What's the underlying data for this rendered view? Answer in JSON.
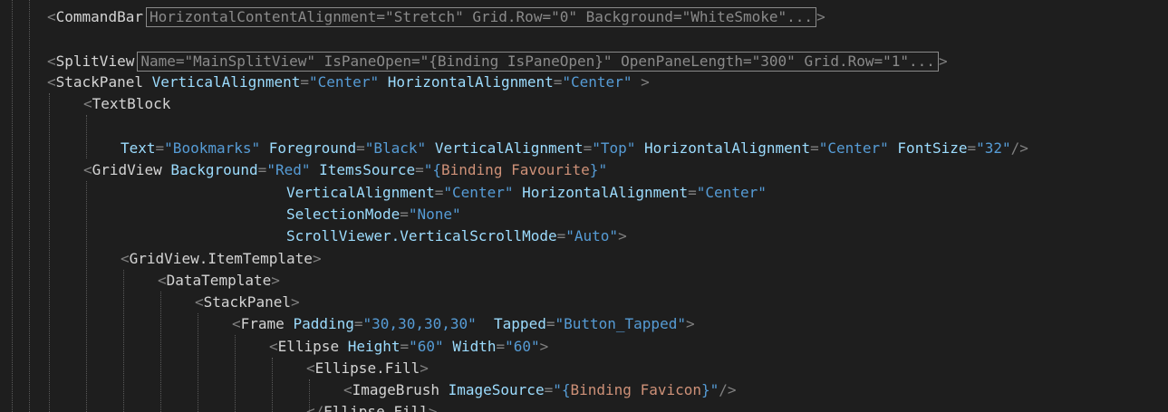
{
  "colors": {
    "background": "#1e1e1e",
    "punctuation": "#808080",
    "tag": "#d4d4d4",
    "attribute": "#9cdcfe",
    "string": "#569cd6",
    "binding": "#ce9178",
    "collapsed": "#8a8a8a",
    "indent_guide": "#5a5a5a"
  },
  "lines": [
    {
      "id": "commandbar",
      "tokens": [
        {
          "t": "punc",
          "v": "<"
        },
        {
          "t": "tag",
          "v": "CommandBar"
        }
      ],
      "collapsed": "HorizontalContentAlignment=\"Stretch\" Grid.Row=\"0\" Background=\"WhiteSmoke\"...",
      "collapsed_end": ">"
    },
    {
      "id": "splitview",
      "tokens": [
        {
          "t": "punc",
          "v": "<"
        },
        {
          "t": "tag",
          "v": "SplitView"
        }
      ],
      "collapsed": "Name=\"MainSplitView\" IsPaneOpen=\"{Binding IsPaneOpen}\" OpenPaneLength=\"300\" Grid.Row=\"1\"...",
      "collapsed_end": ">"
    },
    {
      "id": "stackpanel-outer",
      "tokens": [
        {
          "t": "punc",
          "v": "<"
        },
        {
          "t": "tag",
          "v": "StackPanel"
        },
        {
          "t": "text",
          "v": " "
        },
        {
          "t": "attr",
          "v": "VerticalAlignment"
        },
        {
          "t": "punc",
          "v": "="
        },
        {
          "t": "str",
          "v": "\"Center\""
        },
        {
          "t": "text",
          "v": " "
        },
        {
          "t": "attr",
          "v": "HorizontalAlignment"
        },
        {
          "t": "punc",
          "v": "="
        },
        {
          "t": "str",
          "v": "\"Center\""
        },
        {
          "t": "text",
          "v": " "
        },
        {
          "t": "punc",
          "v": ">"
        }
      ]
    },
    {
      "id": "textblock-open",
      "tokens": [
        {
          "t": "punc",
          "v": "<"
        },
        {
          "t": "tag",
          "v": "TextBlock"
        }
      ]
    },
    {
      "id": "textblock-attrs",
      "tokens": [
        {
          "t": "attr",
          "v": "Text"
        },
        {
          "t": "punc",
          "v": "="
        },
        {
          "t": "str",
          "v": "\"Bookmarks\""
        },
        {
          "t": "text",
          "v": " "
        },
        {
          "t": "attr",
          "v": "Foreground"
        },
        {
          "t": "punc",
          "v": "="
        },
        {
          "t": "str",
          "v": "\"Black\""
        },
        {
          "t": "text",
          "v": " "
        },
        {
          "t": "attr",
          "v": "VerticalAlignment"
        },
        {
          "t": "punc",
          "v": "="
        },
        {
          "t": "str",
          "v": "\"Top\""
        },
        {
          "t": "text",
          "v": " "
        },
        {
          "t": "attr",
          "v": "HorizontalAlignment"
        },
        {
          "t": "punc",
          "v": "="
        },
        {
          "t": "str",
          "v": "\"Center\""
        },
        {
          "t": "text",
          "v": " "
        },
        {
          "t": "attr",
          "v": "FontSize"
        },
        {
          "t": "punc",
          "v": "="
        },
        {
          "t": "str",
          "v": "\"32\""
        },
        {
          "t": "punc",
          "v": "/>"
        }
      ]
    },
    {
      "id": "gridview-open",
      "tokens": [
        {
          "t": "punc",
          "v": "<"
        },
        {
          "t": "tag",
          "v": "GridView"
        },
        {
          "t": "text",
          "v": " "
        },
        {
          "t": "attr",
          "v": "Background"
        },
        {
          "t": "punc",
          "v": "="
        },
        {
          "t": "str",
          "v": "\"Red\""
        },
        {
          "t": "text",
          "v": " "
        },
        {
          "t": "attr",
          "v": "ItemsSource"
        },
        {
          "t": "punc",
          "v": "="
        },
        {
          "t": "str",
          "v": "\""
        },
        {
          "t": "str",
          "v": "{"
        },
        {
          "t": "bind",
          "v": "Binding"
        },
        {
          "t": "text",
          "v": " "
        },
        {
          "t": "bind",
          "v": "Favourite"
        },
        {
          "t": "str",
          "v": "}"
        },
        {
          "t": "str",
          "v": "\""
        }
      ]
    },
    {
      "id": "gridview-alignment",
      "tokens": [
        {
          "t": "attr",
          "v": "VerticalAlignment"
        },
        {
          "t": "punc",
          "v": "="
        },
        {
          "t": "str",
          "v": "\"Center\""
        },
        {
          "t": "text",
          "v": " "
        },
        {
          "t": "attr",
          "v": "HorizontalAlignment"
        },
        {
          "t": "punc",
          "v": "="
        },
        {
          "t": "str",
          "v": "\"Center\""
        }
      ]
    },
    {
      "id": "gridview-selection",
      "tokens": [
        {
          "t": "attr",
          "v": "SelectionMode"
        },
        {
          "t": "punc",
          "v": "="
        },
        {
          "t": "str",
          "v": "\"None\""
        }
      ]
    },
    {
      "id": "gridview-scroll",
      "tokens": [
        {
          "t": "attr",
          "v": "ScrollViewer.VerticalScrollMode"
        },
        {
          "t": "punc",
          "v": "="
        },
        {
          "t": "str",
          "v": "\"Auto\""
        },
        {
          "t": "punc",
          "v": ">"
        }
      ]
    },
    {
      "id": "itemtemplate-open",
      "tokens": [
        {
          "t": "punc",
          "v": "<"
        },
        {
          "t": "tag",
          "v": "GridView.ItemTemplate"
        },
        {
          "t": "punc",
          "v": ">"
        }
      ]
    },
    {
      "id": "datatemplate-open",
      "tokens": [
        {
          "t": "punc",
          "v": "<"
        },
        {
          "t": "tag",
          "v": "DataTemplate"
        },
        {
          "t": "punc",
          "v": ">"
        }
      ]
    },
    {
      "id": "stackpanel-inner",
      "tokens": [
        {
          "t": "punc",
          "v": "<"
        },
        {
          "t": "tag",
          "v": "StackPanel"
        },
        {
          "t": "punc",
          "v": ">"
        }
      ]
    },
    {
      "id": "frame-open",
      "tokens": [
        {
          "t": "punc",
          "v": "<"
        },
        {
          "t": "tag",
          "v": "Frame"
        },
        {
          "t": "text",
          "v": " "
        },
        {
          "t": "attr",
          "v": "Padding"
        },
        {
          "t": "punc",
          "v": "="
        },
        {
          "t": "str",
          "v": "\"30,30,30,30\""
        },
        {
          "t": "text",
          "v": "  "
        },
        {
          "t": "attr",
          "v": "Tapped"
        },
        {
          "t": "punc",
          "v": "="
        },
        {
          "t": "str",
          "v": "\"Button_Tapped\""
        },
        {
          "t": "punc",
          "v": ">"
        }
      ]
    },
    {
      "id": "ellipse-open",
      "tokens": [
        {
          "t": "punc",
          "v": "<"
        },
        {
          "t": "tag",
          "v": "Ellipse"
        },
        {
          "t": "text",
          "v": " "
        },
        {
          "t": "attr",
          "v": "Height"
        },
        {
          "t": "punc",
          "v": "="
        },
        {
          "t": "str",
          "v": "\"60\""
        },
        {
          "t": "text",
          "v": " "
        },
        {
          "t": "attr",
          "v": "Width"
        },
        {
          "t": "punc",
          "v": "="
        },
        {
          "t": "str",
          "v": "\"60\""
        },
        {
          "t": "punc",
          "v": ">"
        }
      ]
    },
    {
      "id": "ellipse-fill-open",
      "tokens": [
        {
          "t": "punc",
          "v": "<"
        },
        {
          "t": "tag",
          "v": "Ellipse.Fill"
        },
        {
          "t": "punc",
          "v": ">"
        }
      ]
    },
    {
      "id": "imagebrush",
      "tokens": [
        {
          "t": "punc",
          "v": "<"
        },
        {
          "t": "tag",
          "v": "ImageBrush"
        },
        {
          "t": "text",
          "v": " "
        },
        {
          "t": "attr",
          "v": "ImageSource"
        },
        {
          "t": "punc",
          "v": "="
        },
        {
          "t": "str",
          "v": "\""
        },
        {
          "t": "str",
          "v": "{"
        },
        {
          "t": "bind",
          "v": "Binding"
        },
        {
          "t": "text",
          "v": " "
        },
        {
          "t": "bind",
          "v": "Favicon"
        },
        {
          "t": "str",
          "v": "}"
        },
        {
          "t": "str",
          "v": "\""
        },
        {
          "t": "punc",
          "v": "/>"
        }
      ]
    },
    {
      "id": "ellipse-fill-close",
      "tokens": [
        {
          "t": "punc",
          "v": "</"
        },
        {
          "t": "tag",
          "v": "Ellipse.Fill"
        },
        {
          "t": "punc",
          "v": ">"
        }
      ]
    }
  ]
}
